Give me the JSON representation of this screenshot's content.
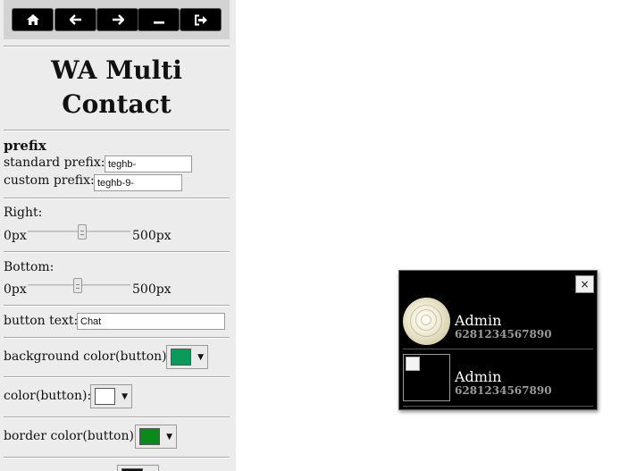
{
  "toolbar": {
    "buttons": [
      {
        "icon": "home-icon"
      },
      {
        "icon": "arrow-left-icon"
      },
      {
        "icon": "arrow-right-icon"
      },
      {
        "icon": "minimize-icon"
      },
      {
        "icon": "sign-out-icon"
      }
    ]
  },
  "panel": {
    "title": "WA Multi Contact",
    "prefix": {
      "heading": "prefix",
      "standard_label": "standard prefix:",
      "standard_value": "teghb-",
      "custom_label": "custom prefix:",
      "custom_value": "teghb-9-"
    },
    "right": {
      "label": "Right:",
      "min": "0px",
      "max": "500px",
      "level": 0.53
    },
    "bottom": {
      "label": "Bottom:",
      "min": "0px",
      "max": "500px",
      "level": 0.49
    },
    "button_text": {
      "label": "button text:",
      "value": "Chat"
    },
    "bg_color": {
      "label": "background color(button):",
      "value": "#0a9a5a"
    },
    "text_color": {
      "label": "color(button):",
      "value": "#ffffff"
    },
    "border_color": {
      "label": "border color(button):",
      "value": "#0a8a1a"
    },
    "next_color": {
      "value": "#111111"
    }
  },
  "chat": {
    "close": "×",
    "contacts": [
      {
        "name": "Admin",
        "number": "6281234567890",
        "avatar": "flower-photo"
      },
      {
        "name": "Admin",
        "number": "6281234567890",
        "avatar": "broken-image"
      }
    ]
  }
}
